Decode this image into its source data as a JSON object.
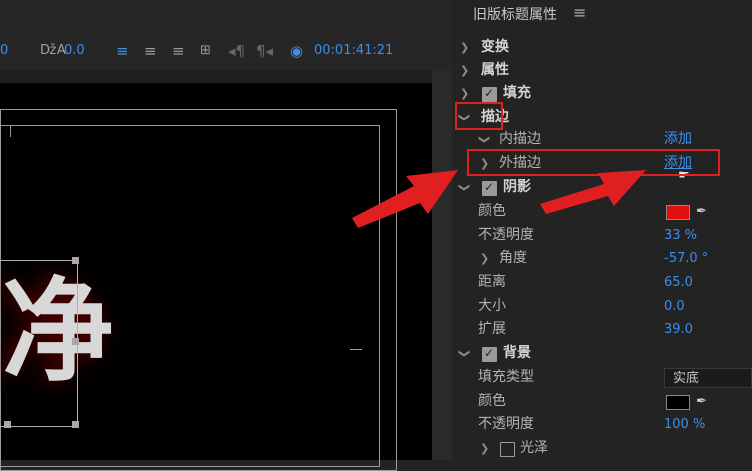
{
  "toolbar": {
    "field_a_value": "0",
    "field_b_value": "0.0",
    "timecode": "00:01:41:21"
  },
  "canvas": {
    "text": "净"
  },
  "panel": {
    "title": "旧版标题属性",
    "menu_icon": "hamburger-icon",
    "rows": {
      "transform": "变换",
      "properties": "属性",
      "fill": "填充",
      "stroke": "描边",
      "inner_stroke": "内描边",
      "inner_stroke_action": "添加",
      "outer_stroke": "外描边",
      "outer_stroke_action": "添加",
      "shadow": "阴影",
      "shadow_color": "颜色",
      "shadow_opacity": "不透明度",
      "shadow_opacity_value": "33 %",
      "shadow_angle": "角度",
      "shadow_angle_value": "-57.0 °",
      "shadow_distance": "距离",
      "shadow_distance_value": "65.0",
      "shadow_size": "大小",
      "shadow_size_value": "0.0",
      "shadow_spread": "扩展",
      "shadow_spread_value": "39.0",
      "background": "背景",
      "fill_type": "填充类型",
      "fill_type_value": "实底",
      "bg_color": "颜色",
      "bg_opacity": "不透明度",
      "bg_opacity_value": "100 %",
      "sheen": "光泽"
    },
    "colors": {
      "shadow_swatch": "#e01010",
      "background_swatch": "#000000",
      "accent": "#3d8ee8",
      "annotation": "#e02020"
    }
  }
}
